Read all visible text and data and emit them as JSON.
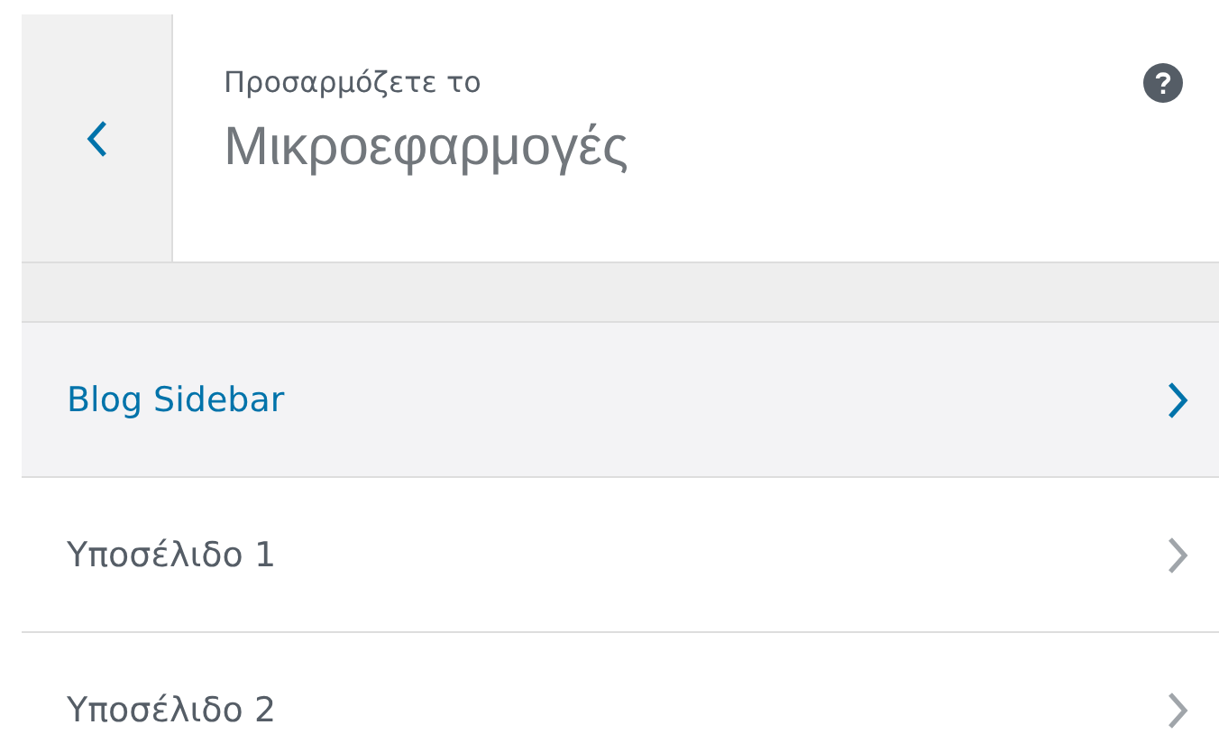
{
  "header": {
    "subtitle": "Προσαρμόζετε το",
    "title": "Μικροεφαρμογές"
  },
  "sections": [
    {
      "label": "Blog Sidebar",
      "selected": true
    },
    {
      "label": "Υποσέλιδο 1",
      "selected": false
    },
    {
      "label": "Υποσέλιδο 2",
      "selected": false
    }
  ]
}
